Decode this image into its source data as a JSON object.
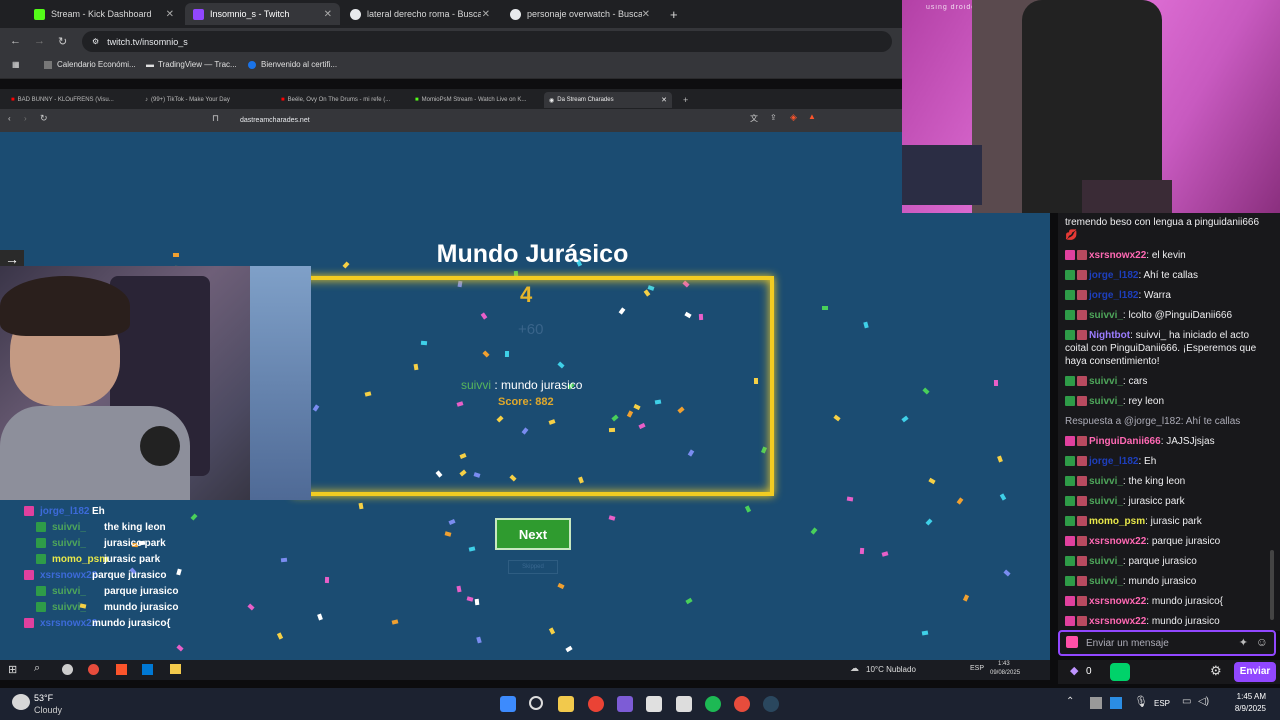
{
  "outer_browser": {
    "tabs": [
      {
        "label": "Stream - Kick Dashboard",
        "color": "#53fc18"
      },
      {
        "label": "Insomnio_s - Twitch",
        "color": "#9147ff"
      },
      {
        "label": "lateral derecho roma - Buscar c",
        "color": "#e8eaed"
      },
      {
        "label": "personaje overwatch - Buscar c",
        "color": "#e8eaed"
      }
    ],
    "url": "twitch.tv/insomnio_s",
    "bookmarks": [
      "Calendario Económi...",
      "TradingView — Trac...",
      "Bienvenido al certifi..."
    ]
  },
  "inner_browser": {
    "tabs": [
      "BAD BUNNY - KLOuFRENS (Visu...",
      "(99+) TikTok - Make Your Day",
      "Beéle, Ovy On The Drums - mi refe (...",
      "MomioPsM Stream - Watch Live on K...",
      "Da Stream Charades"
    ],
    "url": "dastreamcharades.net"
  },
  "game": {
    "word": "Mundo Jurásico",
    "count": "4",
    "plus": "+60",
    "guess_user": "suivvi",
    "guess_text": ": mundo jurasico",
    "score": "Score: 882",
    "next_label": "Next",
    "faint_label": "Skipped"
  },
  "overlay_chat": [
    {
      "user": "jorge_l182",
      "text": "Eh",
      "ucolor": "#3c6ad8"
    },
    {
      "user": "suivvi_",
      "text": "the king leon",
      "ucolor": "#4ea65a"
    },
    {
      "user": "suivvi_",
      "text": "jurasicc park",
      "ucolor": "#4ea65a"
    },
    {
      "user": "momo_psm",
      "text": "jurasic park",
      "ucolor": "#e8e84a"
    },
    {
      "user": "xsrsnowx22",
      "text": "parque jurasico",
      "ucolor": "#3c6ad8"
    },
    {
      "user": "suivvi_",
      "text": "parque jurasico",
      "ucolor": "#4ea65a"
    },
    {
      "user": "suivvi_",
      "text": "mundo jurasico",
      "ucolor": "#4ea65a"
    },
    {
      "user": "xsrsnowx22",
      "text": "mundo jurasico{",
      "ucolor": "#3c6ad8"
    }
  ],
  "chat": {
    "messages": [
      {
        "user": "",
        "text": "tremendo beso con lengua a pinguidanii666 💋",
        "ucolor": "#efeff1"
      },
      {
        "user": "xsrsnowx22",
        "text": ": el kevin",
        "ucolor": "#ff69b4"
      },
      {
        "user": "jorge_l182",
        "text": ": Ahí te callas",
        "ucolor": "#1e3fbd"
      },
      {
        "user": "jorge_l182",
        "text": ": Warra",
        "ucolor": "#1e3fbd"
      },
      {
        "user": "suivvi_",
        "text": ": lcolto @PinguiDanii666",
        "ucolor": "#4ea65a"
      },
      {
        "user": "Nightbot",
        "text": ": suivvi_ ha iniciado el acto coital con PinguiDanii666. ¡Esperemos que haya consentimiento!",
        "ucolor": "#9b7cff"
      },
      {
        "user": "suivvi_",
        "text": ": cars",
        "ucolor": "#4ea65a"
      },
      {
        "user": "suivvi_",
        "text": ": rey leon",
        "ucolor": "#4ea65a"
      },
      {
        "user": "",
        "text": "Respuesta a @jorge_l182: Ahí te callas",
        "ucolor": "#adadb8"
      },
      {
        "user": "PinguiDanii666",
        "text": ": JAJSJjsjas",
        "ucolor": "#ff69b4"
      },
      {
        "user": "jorge_l182",
        "text": ": Eh",
        "ucolor": "#1e3fbd"
      },
      {
        "user": "suivvi_",
        "text": ": the king leon",
        "ucolor": "#4ea65a"
      },
      {
        "user": "suivvi_",
        "text": ": jurasicc park",
        "ucolor": "#4ea65a"
      },
      {
        "user": "momo_psm",
        "text": ": jurasic park",
        "ucolor": "#e8e84a"
      },
      {
        "user": "xsrsnowx22",
        "text": ": parque jurasico",
        "ucolor": "#ff69b4"
      },
      {
        "user": "suivvi_",
        "text": ": parque jurasico",
        "ucolor": "#4ea65a"
      },
      {
        "user": "suivvi_",
        "text": ": mundo jurasico",
        "ucolor": "#4ea65a"
      },
      {
        "user": "xsrsnowx22",
        "text": ": mundo jurasico{",
        "ucolor": "#ff69b4"
      },
      {
        "user": "xsrsnowx22",
        "text": ": mundo jurasico",
        "ucolor": "#ff69b4"
      }
    ],
    "input_placeholder": "Enviar un mensaje",
    "points": "0",
    "send_label": "Enviar"
  },
  "inner_taskbar": {
    "weather": "10°C Nublado",
    "lang": "ESP",
    "time": "1:43",
    "date": "09/08/2025"
  },
  "taskbar": {
    "temp": "53°F",
    "condition": "Cloudy",
    "lang": "ESP",
    "time": "1:45 AM",
    "date": "8/9/2025"
  },
  "cam_watermark": "using droidcam app"
}
